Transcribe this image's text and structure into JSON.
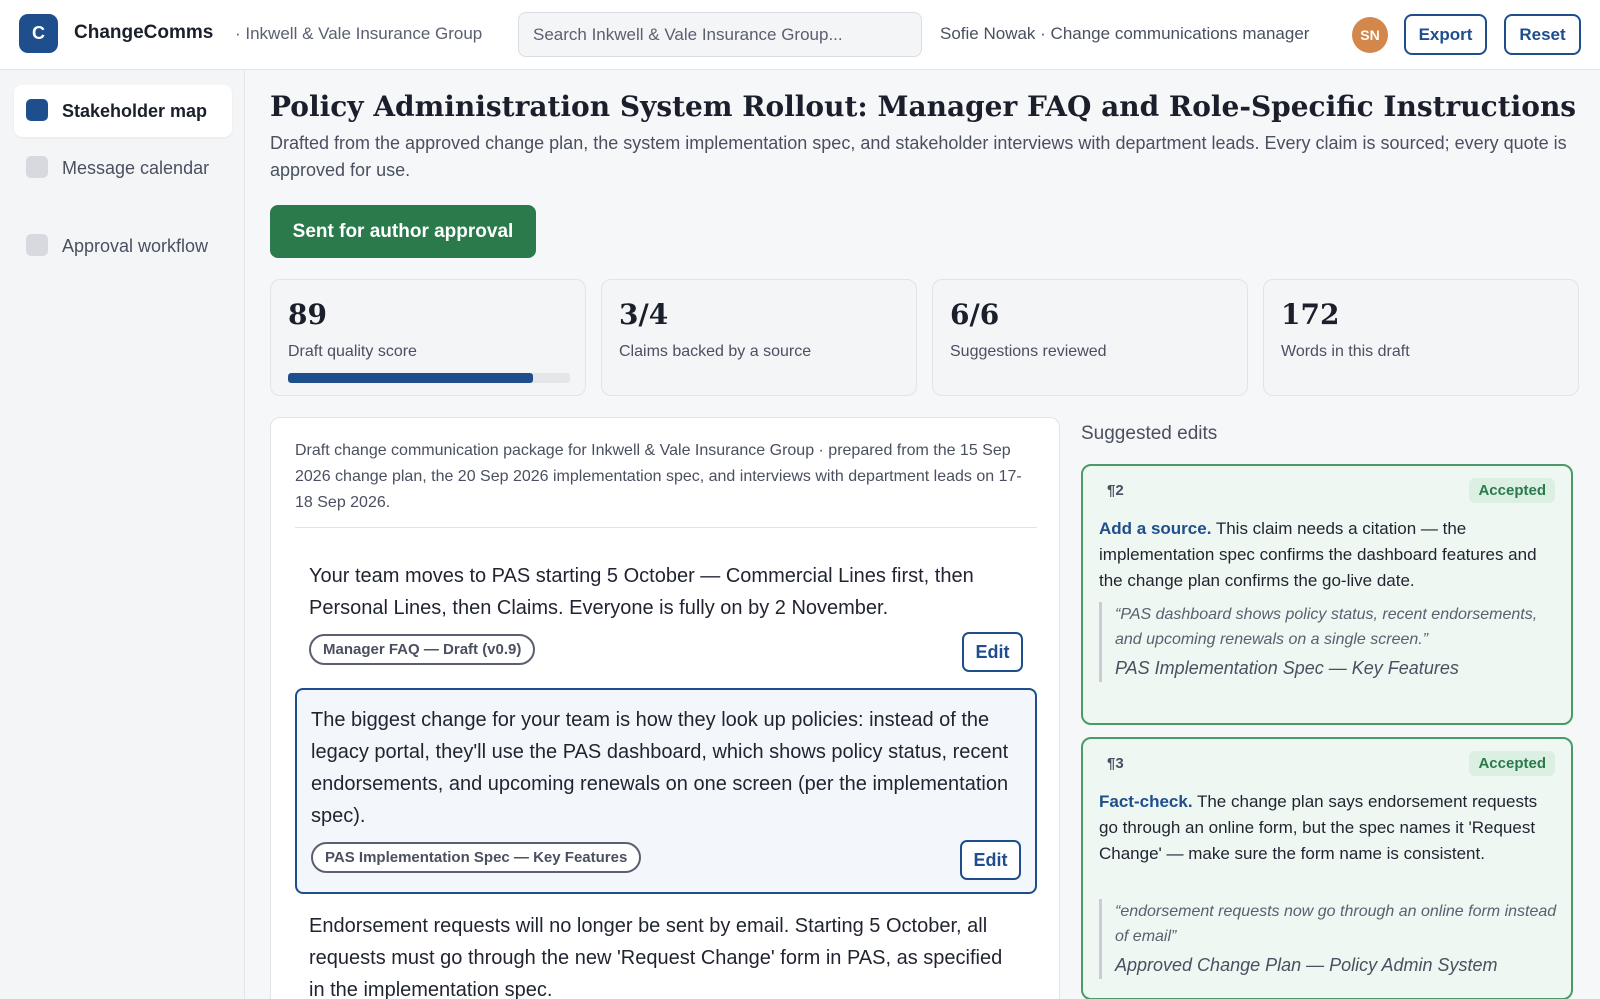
{
  "app": {
    "logo_letter": "C",
    "name": "ChangeComms",
    "org": "· Inkwell & Vale Insurance Group"
  },
  "search": {
    "placeholder": "Search Inkwell & Vale Insurance Group..."
  },
  "user": {
    "line": "Sofie Nowak · Change communications manager",
    "initials": "SN"
  },
  "toolbar": {
    "export_label": "Export",
    "reset_label": "Reset"
  },
  "colors": {
    "accent": "#1f4e8c",
    "success": "#2a7a4b",
    "avatar": "#d4874a"
  },
  "sidebar": {
    "items": [
      {
        "label": "Stakeholder map",
        "active": true
      },
      {
        "label": "Message calendar",
        "active": false
      },
      {
        "label": "Approval workflow",
        "active": false
      }
    ]
  },
  "page": {
    "title": "Policy Administration System Rollout: Manager FAQ and Role-Specific Instructions",
    "subtitle": "Drafted from the approved change plan, the system implementation spec, and stakeholder interviews with department leads. Every claim is sourced; every quote is approved for use.",
    "status_label": "Sent for author approval"
  },
  "stats": [
    {
      "value": "89",
      "label": "Draft quality score",
      "progress": 0.87
    },
    {
      "value": "3/4",
      "label": "Claims backed by a source"
    },
    {
      "value": "6/6",
      "label": "Suggestions reviewed"
    },
    {
      "value": "172",
      "label": "Words in this draft"
    }
  ],
  "draft": {
    "meta": "Draft change communication package for Inkwell & Vale Insurance Group · prepared from the 15 Sep 2026 change plan, the 20 Sep 2026 implementation spec, and interviews with department leads on 17-18 Sep 2026.",
    "edit_label": "Edit",
    "paragraphs": [
      {
        "text": "Your team moves to PAS starting 5 October — Commercial Lines first, then Personal Lines, then Claims. Everyone is fully on by 2 November.",
        "source": "Manager FAQ — Draft (v0.9)"
      },
      {
        "text": "The biggest change for your team is how they look up policies: instead of the legacy portal, they'll use the PAS dashboard, which shows policy status, recent endorsements, and upcoming renewals on one screen (per the implementation spec).",
        "source": "PAS Implementation Spec — Key Features"
      },
      {
        "text": "Endorsement requests will no longer be sent by email. Starting 5 October, all requests must go through the new 'Request Change' form in PAS, as specified in the implementation spec."
      }
    ]
  },
  "suggestions": {
    "heading": "Suggested edits",
    "items": [
      {
        "para": "¶2",
        "status": "Accepted",
        "kind": "Add a source.",
        "body": "This claim needs a citation — the implementation spec confirms the dashboard features and the change plan confirms the go-live date.",
        "quote": "“PAS dashboard shows policy status, recent endorsements, and upcoming renewals on a single screen.”",
        "source": "PAS Implementation Spec — Key Features"
      },
      {
        "para": "¶3",
        "status": "Accepted",
        "kind": "Fact-check.",
        "body": "The change plan says endorsement requests go through an online form, but the spec names it 'Request Change' — make sure the form name is consistent.",
        "quote": "“endorsement requests now go through an online form instead of email”",
        "source": "Approved Change Plan — Policy Admin System"
      }
    ]
  }
}
